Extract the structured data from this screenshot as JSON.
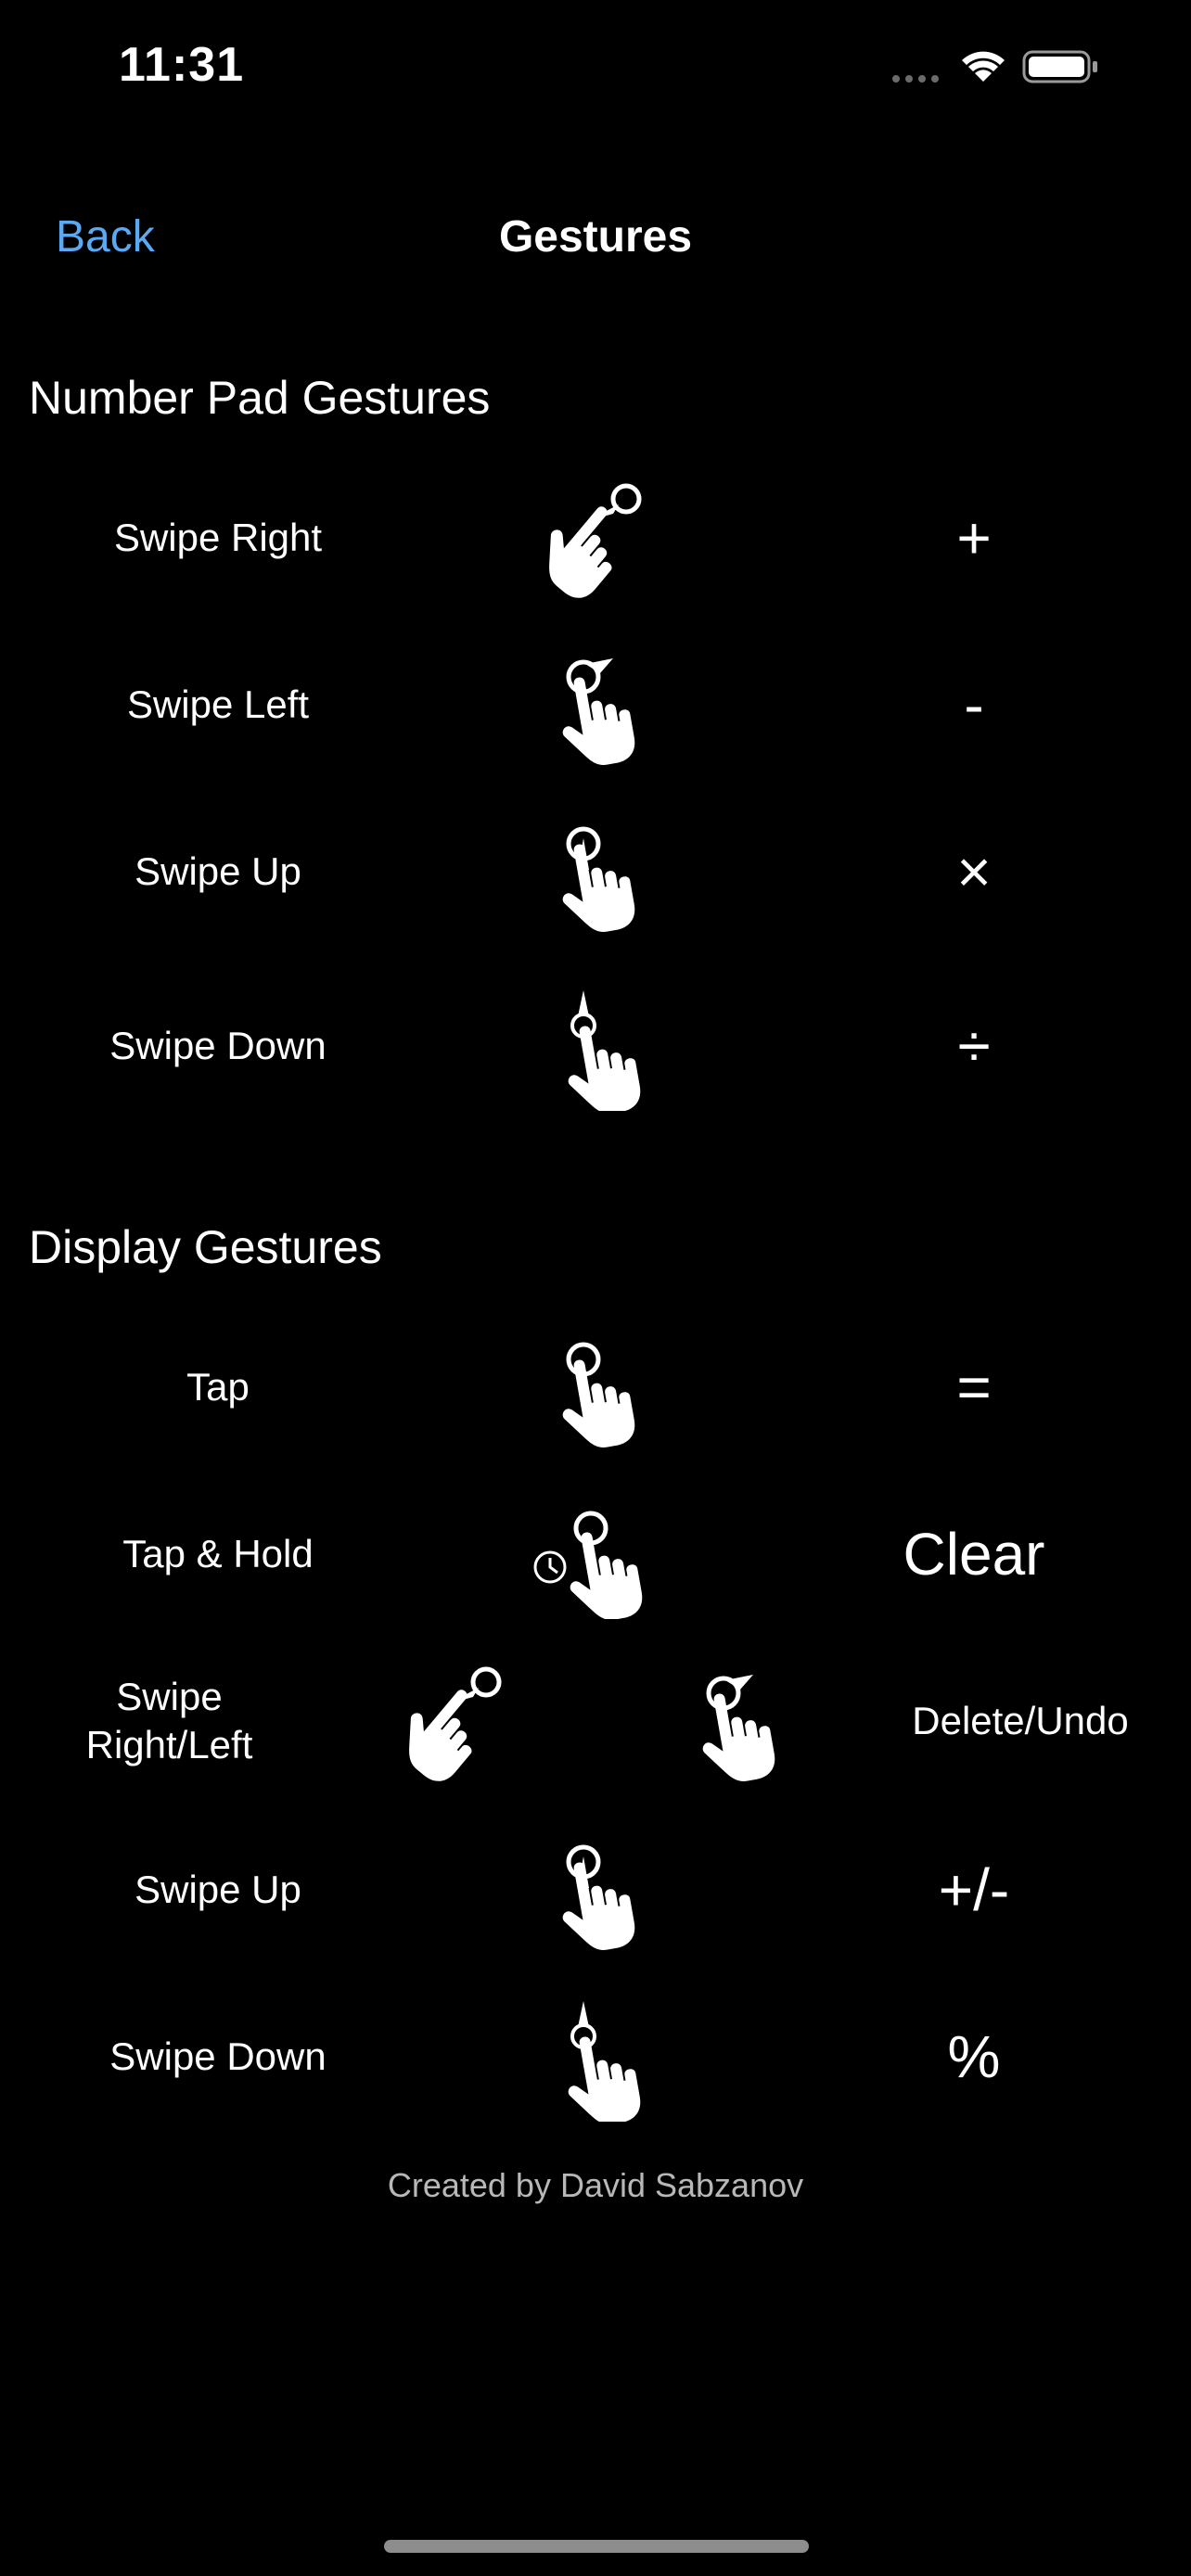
{
  "status_bar": {
    "time": "11:31"
  },
  "nav": {
    "back_label": "Back",
    "title": "Gestures"
  },
  "number_pad": {
    "title": "Number Pad Gestures",
    "rows": [
      {
        "label": "Swipe Right",
        "gesture_icon": "swipe-right-hand-icon",
        "result": "+"
      },
      {
        "label": "Swipe Left",
        "gesture_icon": "swipe-left-hand-icon",
        "result": "-"
      },
      {
        "label": "Swipe Up",
        "gesture_icon": "swipe-up-hand-icon",
        "result": "×"
      },
      {
        "label": "Swipe Down",
        "gesture_icon": "swipe-down-hand-icon",
        "result": "÷"
      }
    ]
  },
  "display": {
    "title": "Display Gestures",
    "rows": [
      {
        "label": "Tap",
        "gesture_icon": "tap-hand-icon",
        "result": "="
      },
      {
        "label": "Tap & Hold",
        "gesture_icon": "tap-hold-hand-icon",
        "result": "Clear"
      },
      {
        "label": "Swipe\nRight/Left",
        "gesture_icon": "swipe-right-hand-icon",
        "gesture_icon_alt": "swipe-left-hand-icon",
        "result": "Delete/Undo"
      },
      {
        "label": "Swipe Up",
        "gesture_icon": "swipe-up-hand-icon",
        "result": "+/-"
      },
      {
        "label": "Swipe Down",
        "gesture_icon": "swipe-down-hand-icon",
        "result": "%"
      }
    ]
  },
  "footer": {
    "credit": "Created by David Sabzanov"
  },
  "colors": {
    "background": "#000000",
    "text": "#ffffff",
    "accent": "#5aa9f2",
    "secondary_text": "#b8b8b8"
  }
}
